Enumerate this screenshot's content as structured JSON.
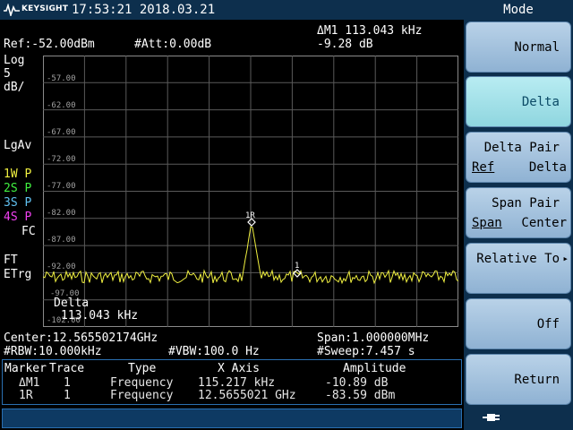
{
  "brand": "KEYSIGHT",
  "datetime": "17:53:21  2018.03.21",
  "header": {
    "ref": "Ref:-52.00dBm",
    "att": "#Att:0.00dB",
    "marker_line1": "ΔM1 113.043 kHz",
    "marker_line2": "-9.28 dB"
  },
  "scale": {
    "line1": "Log",
    "line2": "5",
    "line3": "dB/"
  },
  "detector": "LgAv",
  "traces": [
    {
      "label": "1W P",
      "color": "#f0f040"
    },
    {
      "label": "2S P",
      "color": "#40f040"
    },
    {
      "label": "3S P",
      "color": "#60c0f0"
    },
    {
      "label": "4S P",
      "color": "#f040f0"
    }
  ],
  "fc": "FC",
  "ft": "FT",
  "etrg": "ETrg",
  "y_ticks": [
    "-57.00",
    "-62.00",
    "-67.00",
    "-72.00",
    "-77.00",
    "-82.00",
    "-87.00",
    "-92.00",
    "-97.00",
    "-102.00"
  ],
  "marker_labels": {
    "m1r": "1R",
    "m1": "1"
  },
  "delta_box": {
    "label": "Delta",
    "value": "113.043 kHz"
  },
  "info": {
    "center": "Center:12.565502174GHz",
    "span": "Span:1.000000MHz",
    "rbw": "#RBW:10.000kHz",
    "vbw": "#VBW:100.0 Hz",
    "sweep": "#Sweep:7.457 s"
  },
  "marker_table": {
    "headers": [
      "Marker",
      "Trace",
      "Type",
      "X Axis",
      "Amplitude"
    ],
    "rows": [
      {
        "marker": "ΔM1",
        "trace": "1",
        "type": "Frequency",
        "x": "115.217 kHz",
        "amp": "-10.89 dB"
      },
      {
        "marker": "1R",
        "trace": "1",
        "type": "Frequency",
        "x": "12.5655021 GHz",
        "amp": "-83.59 dBm"
      }
    ]
  },
  "menu": {
    "title": "Mode",
    "items": [
      {
        "label": "Normal"
      },
      {
        "label": "Delta"
      },
      {
        "label": "Delta Pair",
        "left": "Ref",
        "right": "Delta"
      },
      {
        "label": "Span Pair",
        "left": "Span",
        "right": "Center"
      },
      {
        "label": "Relative To",
        "more": "▸"
      },
      {
        "label": "Off"
      },
      {
        "label": "Return"
      }
    ]
  },
  "colors": {
    "trace": "#f0f040",
    "marker": "#ffffff",
    "grid": "#5a5a5a",
    "softkey": "#a9c6e2",
    "softkey_active": "#a6e2ea"
  }
}
